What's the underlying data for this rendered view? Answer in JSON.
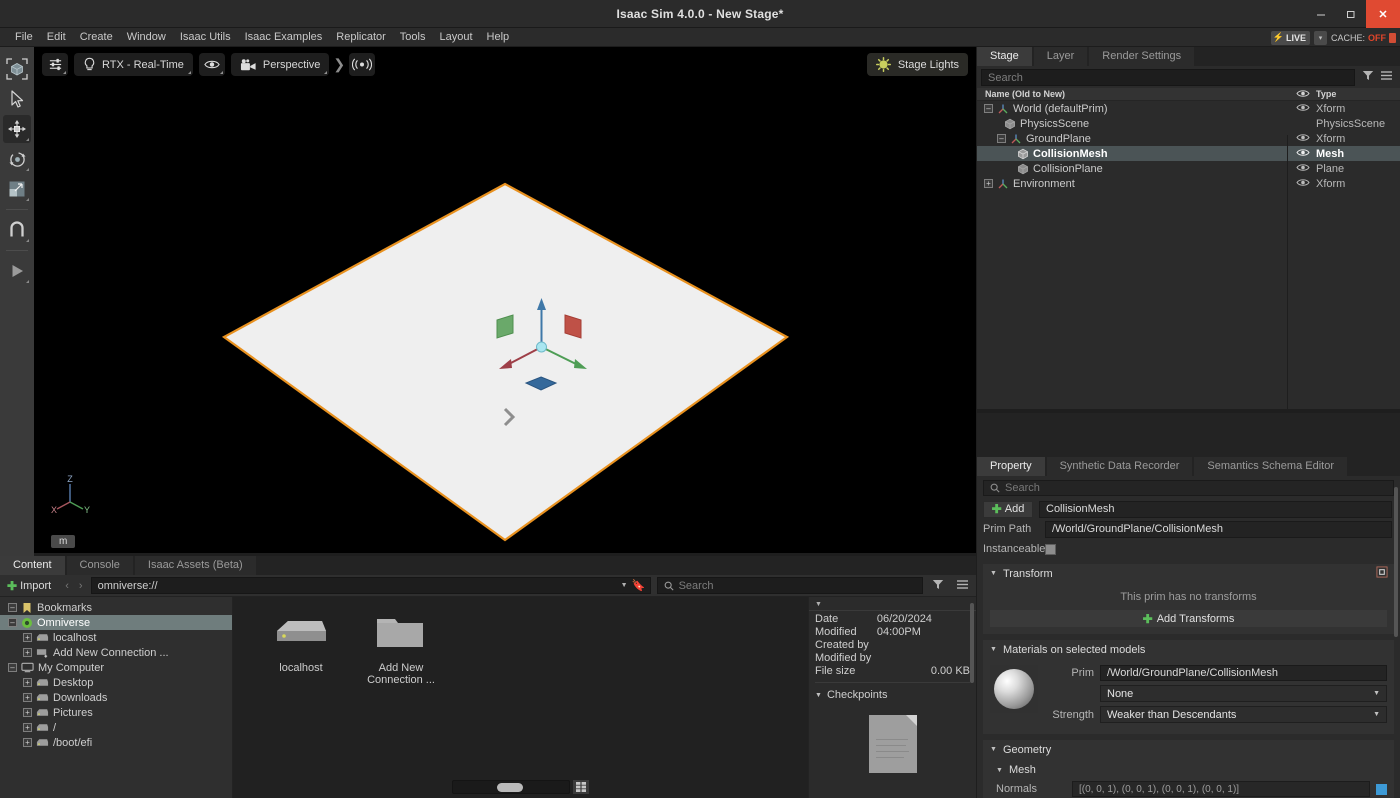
{
  "window": {
    "title": "Isaac Sim 4.0.0 - New Stage*",
    "minimize": "–",
    "maximize": "❐",
    "close": "✕"
  },
  "menubar": {
    "items": [
      "File",
      "Edit",
      "Create",
      "Window",
      "Isaac Utils",
      "Isaac Examples",
      "Replicator",
      "Tools",
      "Layout",
      "Help"
    ],
    "live_label": "LIVE",
    "live_bolt": "lightning-icon",
    "live_caret": "▾",
    "cache_label": "CACHE:",
    "cache_state": "OFF"
  },
  "toolrail": {
    "items": [
      {
        "name": "select-box-tool",
        "icon": "bounding-box-icon"
      },
      {
        "name": "select-tool",
        "icon": "cursor-arrow-icon"
      },
      {
        "name": "move-tool",
        "icon": "move-gizmo-icon",
        "active": true
      },
      {
        "name": "rotate-tool",
        "icon": "rotate-gizmo-icon"
      },
      {
        "name": "scale-tool",
        "icon": "scale-gizmo-icon"
      },
      {
        "name": "snap-tool",
        "icon": "magnet-icon"
      },
      {
        "name": "play-tool",
        "icon": "play-icon"
      }
    ]
  },
  "viewport": {
    "settings_icon": "sliders-icon",
    "renderer_icon": "lightbulb-icon",
    "renderer_label": "RTX - Real-Time",
    "visibility_icon": "eye-icon",
    "camera_icon": "camera-icon",
    "camera_label": "Perspective",
    "chevrons": "❯",
    "sensor_icon": "sensor-icon",
    "stage_lights_icon": "light-bulb-round-icon",
    "stage_lights_label": "Stage Lights",
    "axis_x": "X",
    "axis_y": "Y",
    "axis_z": "Z",
    "unit": "m"
  },
  "content": {
    "tabs": [
      {
        "label": "Content",
        "active": true
      },
      {
        "label": "Console",
        "active": false
      },
      {
        "label": "Isaac Assets (Beta)",
        "active": false
      }
    ],
    "import_label": "Import",
    "nav_back": "‹",
    "nav_forward": "›",
    "path_value": "omniverse://",
    "path_caret": "▼",
    "bookmark_icon": "bookmark-icon",
    "search_placeholder": "Search",
    "search_icon": "search-icon",
    "filter_icon": "filter-icon",
    "menu_icon": "hamburger-menu-icon",
    "tree": [
      {
        "label": "Bookmarks",
        "icon": "bookmark-icon",
        "expander": "–",
        "indent": 0,
        "selected": false
      },
      {
        "label": "Omniverse",
        "icon": "omniverse-icon",
        "expander": "–",
        "indent": 0,
        "selected": true
      },
      {
        "label": "localhost",
        "icon": "server-icon",
        "expander": "+",
        "indent": 1,
        "selected": false
      },
      {
        "label": "Add New Connection ...",
        "icon": "add-connection-icon",
        "expander": "+",
        "indent": 1,
        "selected": false
      },
      {
        "label": "My Computer",
        "icon": "computer-icon",
        "expander": "–",
        "indent": 0,
        "selected": false
      },
      {
        "label": "Desktop",
        "icon": "drive-icon",
        "expander": "+",
        "indent": 1,
        "selected": false
      },
      {
        "label": "Downloads",
        "icon": "drive-icon",
        "expander": "+",
        "indent": 1,
        "selected": false
      },
      {
        "label": "Pictures",
        "icon": "drive-icon",
        "expander": "+",
        "indent": 1,
        "selected": false
      },
      {
        "label": "/",
        "icon": "drive-icon",
        "expander": "+",
        "indent": 1,
        "selected": false
      },
      {
        "label": "/boot/efi",
        "icon": "drive-icon",
        "expander": "+",
        "indent": 1,
        "selected": false
      }
    ],
    "grid_items": [
      {
        "label": "localhost",
        "icon": "server-thumbnail-icon"
      },
      {
        "label": "Add New Connection ...",
        "icon": "folder-thumbnail-icon"
      }
    ],
    "detail": {
      "caret": "▼",
      "date_modified_label": "Date Modified",
      "date_modified_value": "06/20/2024 04:00PM",
      "created_by_label": "Created by",
      "created_by_value": "",
      "modified_by_label": "Modified by",
      "modified_by_value": "",
      "file_size_label": "File size",
      "file_size_value": "0.00 KB",
      "checkpoints_label": "Checkpoints",
      "checkpoints_caret": "▼"
    },
    "grid_toggle_icon": "grid-view-icon"
  },
  "stage": {
    "tabs": [
      {
        "label": "Stage",
        "active": true
      },
      {
        "label": "Layer",
        "active": false
      },
      {
        "label": "Render Settings",
        "active": false
      }
    ],
    "search_placeholder": "Search",
    "filter_icon": "filter-icon",
    "menu_icon": "hamburger-menu-icon",
    "columns": {
      "name": "Name (Old to New)",
      "eye": "eye-icon",
      "type": "Type"
    },
    "rows": [
      {
        "label": "World (defaultPrim)",
        "type": "Xform",
        "indent": 0,
        "expander": "–",
        "icon": "xform-axis-icon",
        "eye": true,
        "selected": false
      },
      {
        "label": "PhysicsScene",
        "type": "PhysicsScene",
        "indent": 1,
        "expander": "",
        "icon": "cube-icon",
        "eye": false,
        "selected": false
      },
      {
        "label": "GroundPlane",
        "type": "Xform",
        "indent": 1,
        "expander": "–",
        "icon": "xform-axis-icon",
        "eye": true,
        "selected": false
      },
      {
        "label": "CollisionMesh",
        "type": "Mesh",
        "indent": 2,
        "expander": "",
        "icon": "mesh-cube-icon",
        "eye": true,
        "selected": true
      },
      {
        "label": "CollisionPlane",
        "type": "Plane",
        "indent": 2,
        "expander": "",
        "icon": "cube-icon",
        "eye": true,
        "selected": false
      },
      {
        "label": "Environment",
        "type": "Xform",
        "indent": 0,
        "expander": "+",
        "icon": "xform-axis-icon",
        "eye": true,
        "selected": false
      }
    ]
  },
  "property": {
    "tabs": [
      {
        "label": "Property",
        "active": true
      },
      {
        "label": "Synthetic Data Recorder",
        "active": false
      },
      {
        "label": "Semantics Schema Editor",
        "active": false
      }
    ],
    "search_placeholder": "Search",
    "search_icon": "search-icon",
    "add_label": "Add",
    "name_value": "CollisionMesh",
    "prim_path_label": "Prim Path",
    "prim_path_value": "/World/GroundPlane/CollisionMesh",
    "instanceable_label": "Instanceable",
    "instanceable_checked": false,
    "transform": {
      "title": "Transform",
      "caret": "▼",
      "empty_text": "This prim has no transforms",
      "add_transforms_label": "Add Transforms",
      "corner_icon": "transform-target-icon"
    },
    "materials": {
      "title": "Materials on selected models",
      "caret": "▼",
      "prim_label": "Prim",
      "prim_value": "/World/GroundPlane/CollisionMesh",
      "material_value": "None",
      "material_caret": "▼",
      "strength_label": "Strength",
      "strength_value": "Weaker than Descendants",
      "strength_caret": "▼",
      "preview_icon": "material-sphere-preview"
    },
    "geometry": {
      "title": "Geometry",
      "caret": "▼",
      "mesh_title": "Mesh",
      "mesh_caret": "▼",
      "normals_label": "Normals",
      "normals_value": "[(0, 0, 1), (0, 0, 1), (0, 0, 1), (0, 0, 1)]",
      "swatch_color": "#3d9ad6"
    }
  },
  "colors": {
    "accent_orange": "#e8911f",
    "accent_green": "#5bbd5b",
    "selection_blue": "#4b5456",
    "cache_off": "#e0452b",
    "live_yellow": "#f2d02c"
  }
}
